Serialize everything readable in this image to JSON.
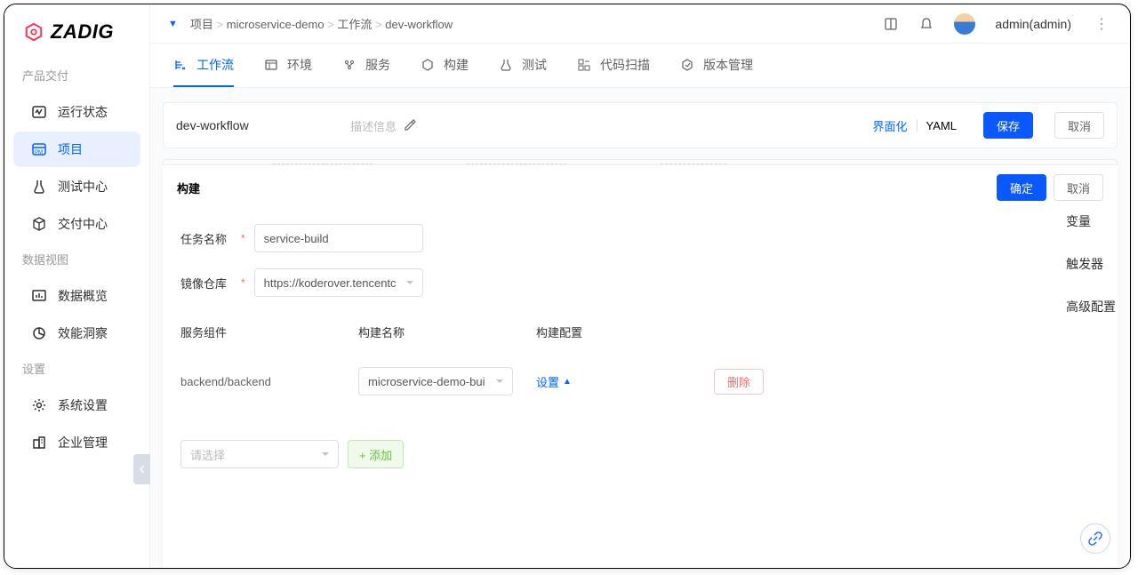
{
  "logo": "ZADIG",
  "sidebar": {
    "sections": [
      {
        "label": "产品交付",
        "items": [
          {
            "label": "运行状态",
            "icon": "activity"
          },
          {
            "label": "项目",
            "icon": "project",
            "active": true
          },
          {
            "label": "测试中心",
            "icon": "flask"
          },
          {
            "label": "交付中心",
            "icon": "box"
          }
        ]
      },
      {
        "label": "数据视图",
        "items": [
          {
            "label": "数据概览",
            "icon": "chart"
          },
          {
            "label": "效能洞察",
            "icon": "pie"
          }
        ]
      },
      {
        "label": "设置",
        "items": [
          {
            "label": "系统设置",
            "icon": "gear"
          },
          {
            "label": "企业管理",
            "icon": "building"
          }
        ]
      }
    ]
  },
  "breadcrumb": [
    "项目",
    "microservice-demo",
    "工作流",
    "dev-workflow"
  ],
  "user": "admin(admin)",
  "tabs": [
    {
      "label": "工作流",
      "active": true
    },
    {
      "label": "环境"
    },
    {
      "label": "服务"
    },
    {
      "label": "构建"
    },
    {
      "label": "测试"
    },
    {
      "label": "代码扫描"
    },
    {
      "label": "版本管理"
    }
  ],
  "workflow": {
    "name": "dev-workflow",
    "desc_placeholder": "描述信息",
    "view_visual": "界面化",
    "view_yaml": "YAML",
    "save": "保存",
    "cancel": "取消"
  },
  "panel": {
    "title": "构建",
    "confirm": "确定",
    "cancel": "取消",
    "task_name_label": "任务名称",
    "task_name_value": "service-build",
    "registry_label": "镜像仓库",
    "registry_value": "https://koderover.tencentc",
    "cols": {
      "service": "服务组件",
      "build_name": "构建名称",
      "build_config": "构建配置"
    },
    "row": {
      "service": "backend/backend",
      "build_name": "microservice-demo-bui",
      "config_link": "设置",
      "delete": "删除"
    },
    "add_placeholder": "请选择",
    "add_label": "+ 添加"
  },
  "rail": {
    "vars": "变量",
    "triggers": "触发器",
    "advanced": "高级配置"
  }
}
